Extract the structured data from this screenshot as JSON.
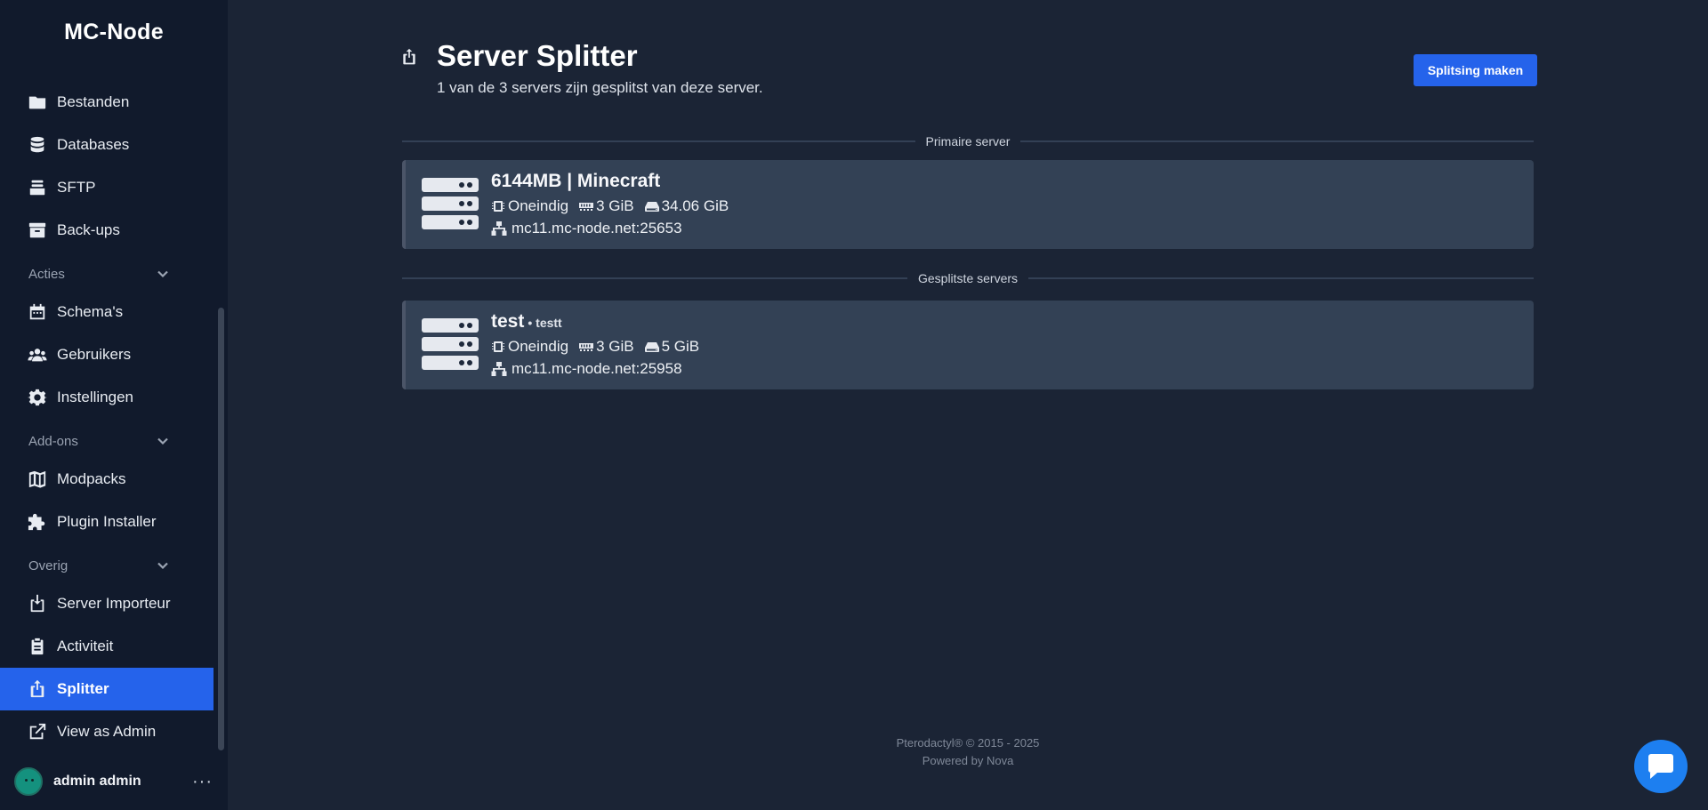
{
  "sidebar": {
    "brand": "MC-Node",
    "cut_item": "",
    "items": {
      "bestanden": "Bestanden",
      "databases": "Databases",
      "sftp": "SFTP",
      "backups": "Back-ups",
      "schemas": "Schema's",
      "gebruikers": "Gebruikers",
      "instellingen": "Instellingen",
      "modpacks": "Modpacks",
      "plugin_installer": "Plugin Installer",
      "server_importeur": "Server Importeur",
      "activiteit": "Activiteit",
      "splitter": "Splitter",
      "view_as_admin": "View as Admin"
    },
    "sections": {
      "acties": "Acties",
      "addons": "Add-ons",
      "overig": "Overig"
    },
    "user": {
      "name": "admin admin",
      "menu": "···"
    }
  },
  "header": {
    "title": "Server Splitter",
    "subtitle": "1 van de 3 servers zijn gesplitst van deze server.",
    "create_button": "Splitsing maken"
  },
  "dividers": {
    "primary": "Primaire server",
    "split": "Gesplitste servers"
  },
  "primary_server": {
    "name": "6144MB | Minecraft",
    "description": "",
    "cpu": "Oneindig",
    "memory": "3 GiB",
    "disk": "34.06 GiB",
    "address": "mc11.mc-node.net:25653"
  },
  "split_servers": [
    {
      "name": "test",
      "description": "• testt",
      "cpu": "Oneindig",
      "memory": "3 GiB",
      "disk": "5 GiB",
      "address": "mc11.mc-node.net:25958"
    }
  ],
  "footer": {
    "copyright": "Pterodactyl® © 2015 - 2025",
    "powered": "Powered by Nova"
  },
  "icons": {
    "page": "export-icon",
    "chat": "chat-icon"
  },
  "colors": {
    "accent": "#2563eb",
    "sidebar_bg": "#111a2c",
    "main_bg": "#1b2435",
    "card_bg": "#334155"
  }
}
